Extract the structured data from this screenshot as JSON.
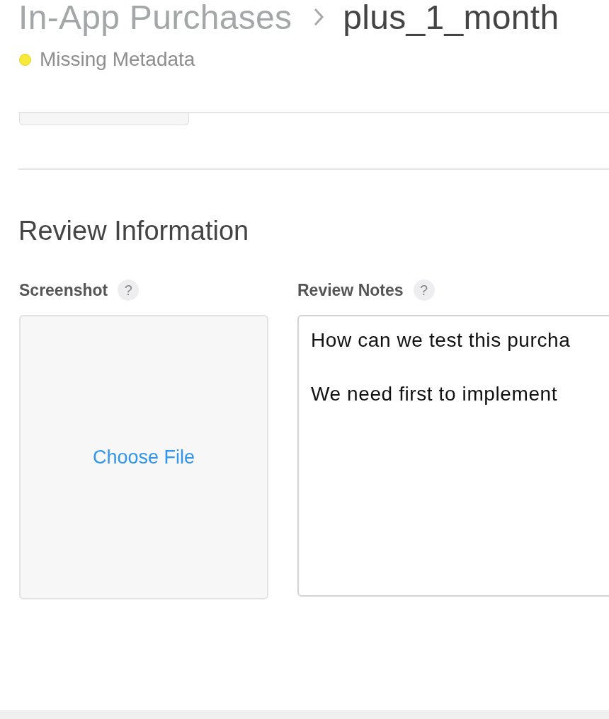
{
  "breadcrumb": {
    "parent": "In-App Purchases",
    "current": "plus_1_month"
  },
  "status": {
    "label": "Missing Metadata",
    "color": "#f7e93a"
  },
  "section": {
    "title": "Review Information"
  },
  "screenshot": {
    "label": "Screenshot",
    "help": "?",
    "action": "Choose File"
  },
  "review_notes": {
    "label": "Review Notes",
    "help": "?",
    "paragraphs": [
      "How can we test this purcha",
      "We need first to implement"
    ]
  }
}
